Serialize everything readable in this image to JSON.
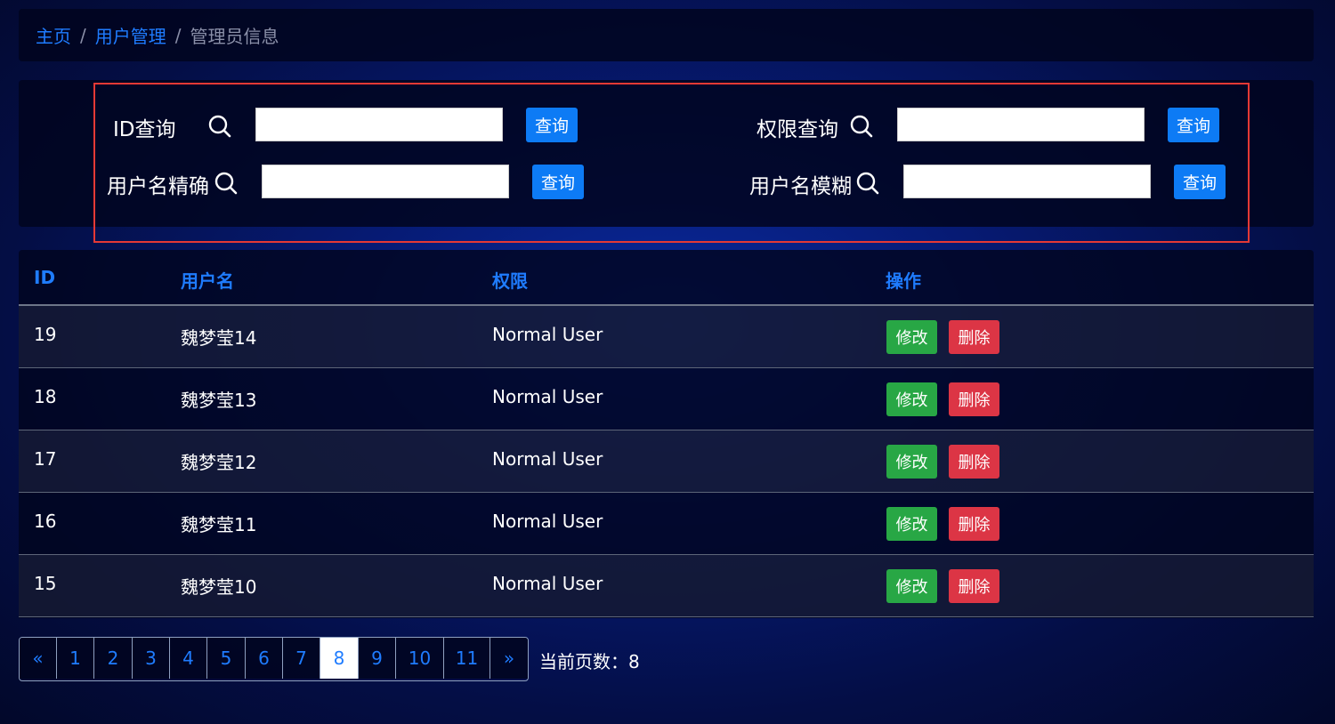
{
  "breadcrumb": {
    "home": "主页",
    "section": "用户管理",
    "current": "管理员信息",
    "separator": "/"
  },
  "search": {
    "id": {
      "label": "ID查询",
      "button": "查询",
      "value": ""
    },
    "role": {
      "label": "权限查询",
      "button": "查询",
      "value": ""
    },
    "exact": {
      "label": "用户名精确",
      "button": "查询",
      "value": ""
    },
    "fuzzy": {
      "label": "用户名模糊",
      "button": "查询",
      "value": ""
    }
  },
  "table": {
    "headers": [
      "ID",
      "用户名",
      "权限",
      "操作"
    ],
    "rows": [
      {
        "id": "19",
        "name": "魏梦莹14",
        "role": "Normal User"
      },
      {
        "id": "18",
        "name": "魏梦莹13",
        "role": "Normal User"
      },
      {
        "id": "17",
        "name": "魏梦莹12",
        "role": "Normal User"
      },
      {
        "id": "16",
        "name": "魏梦莹11",
        "role": "Normal User"
      },
      {
        "id": "15",
        "name": "魏梦莹10",
        "role": "Normal User"
      }
    ],
    "edit_label": "修改",
    "delete_label": "删除"
  },
  "pagination": {
    "prev": "«",
    "next": "»",
    "pages": [
      "1",
      "2",
      "3",
      "4",
      "5",
      "6",
      "7",
      "8",
      "9",
      "10",
      "11"
    ],
    "active": "8",
    "current_label": "当前页数：8"
  },
  "colors": {
    "accent": "#1f7cff",
    "button": "#0d7bf5",
    "edit": "#28a745",
    "delete": "#dc3545",
    "highlight_border": "#e53935"
  }
}
